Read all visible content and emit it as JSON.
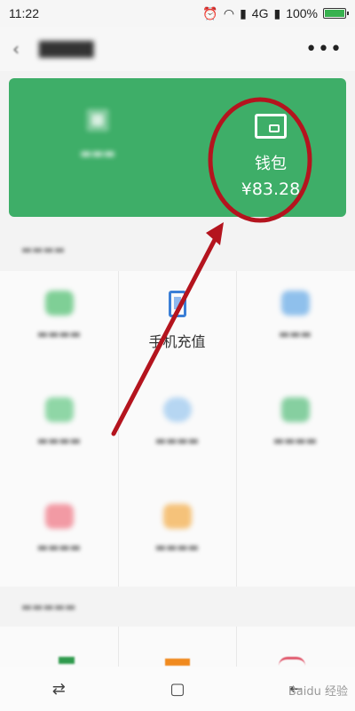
{
  "status_bar": {
    "time": "11:22",
    "network": "4G",
    "battery": "100%",
    "battery_level": 1.0
  },
  "header": {
    "more_label": "•••"
  },
  "wallet": {
    "label": "钱包",
    "amount": "¥83.28"
  },
  "services": {
    "phone_recharge_label": "手机充值"
  },
  "colors": {
    "green": "#3eae68",
    "annotation_red": "#b4141e"
  },
  "watermark": "Baidu 经验"
}
